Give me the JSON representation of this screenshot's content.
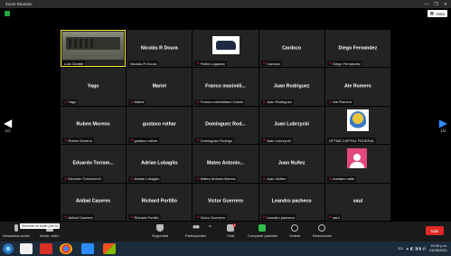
{
  "window": {
    "title": "Zoom Reunión",
    "controls": [
      "—",
      "❐",
      "✕"
    ],
    "view_label": "Vista"
  },
  "gallery": {
    "tiles": [
      {
        "display": "",
        "label": "Luis Gentile",
        "muted": false,
        "thumb": "camera",
        "active": true
      },
      {
        "display": "Nicolás R Doura",
        "label": "Nicolás R Doura",
        "muted": false
      },
      {
        "display": "",
        "label": "Pablo Logando",
        "muted": true,
        "thumb": "car"
      },
      {
        "display": "Cardozo",
        "label": "Cardozo",
        "muted": true
      },
      {
        "display": "Diego Fernandez",
        "label": "Diego Fernandez",
        "muted": true
      },
      {
        "display": "Yago",
        "label": "Yago",
        "muted": true
      },
      {
        "display": "Mariel",
        "label": "Mariel",
        "muted": true
      },
      {
        "display": "Franco  maximili...",
        "label": "Franco maximiliano Castro",
        "muted": true
      },
      {
        "display": "Juan Rodriguez",
        "label": "Juan Rodriguez",
        "muted": true
      },
      {
        "display": "Ale Romero",
        "label": "Ale Romero",
        "muted": true
      },
      {
        "display": "Ruben Moreno",
        "label": "Ruben Moreno",
        "muted": true
      },
      {
        "display": "gustavo rothar",
        "label": "gustavo rothar",
        "muted": true
      },
      {
        "display": "Dominguez  Rod...",
        "label": "Dominguez Rodrigo",
        "muted": true
      },
      {
        "display": "Juan Lubrzycki",
        "label": "Juan Lubrzycki",
        "muted": true
      },
      {
        "display": "",
        "label": "UFTMA CAPITAL FEDERAL",
        "muted": false,
        "thumb": "logo"
      },
      {
        "display": "Eduardo  Torram...",
        "label": "Eduardo Torramorell",
        "muted": true
      },
      {
        "display": "Adrian Lobaglio",
        "label": "Adrian Lobaglio",
        "muted": true
      },
      {
        "display": "Mateo  Antonio...",
        "label": "Mateo Antonio Barrea",
        "muted": true
      },
      {
        "display": "Juan Nuñez",
        "label": "Juan Nuñez",
        "muted": true
      },
      {
        "display": "",
        "label": "mariano valle",
        "muted": true,
        "thumb": "avatar"
      },
      {
        "display": "Anibal Caseres",
        "label": "Anibal Caseres",
        "muted": true
      },
      {
        "display": "Richard Portillo",
        "label": "Richard Portillo",
        "muted": true
      },
      {
        "display": "Victor Guerrero",
        "label": "Victor Guerrero",
        "muted": true
      },
      {
        "display": "Leandro pacheco",
        "label": "Leandro pacheco",
        "muted": true
      },
      {
        "display": "saul",
        "label": "saul",
        "muted": true
      }
    ]
  },
  "pager": {
    "left_page": "1/2",
    "right_page": "1/2"
  },
  "toolbar": {
    "mute_label": "Desactivar audio",
    "video_label": "Iniciar video",
    "tooltip": "Silenciar mi audio (Alt+A)",
    "security_label": "Seguridad",
    "participants_label": "Participantes",
    "participants_count": "34",
    "chat_label": "Chat",
    "chat_badge": "1",
    "share_label": "Compartir pantalla",
    "record_label": "Grabar",
    "reactions_label": "Reacciones",
    "leave_label": "Salir"
  },
  "taskbar": {
    "lang": "ES",
    "time": "10:09 p.m.",
    "date": "24/05/2021"
  },
  "colors": {
    "active_speaker": "#f6e83b",
    "mute_red": "#e02828",
    "share_green": "#2fbf4a",
    "leave_red": "#e02828",
    "arrow_blue": "#2d8cff"
  }
}
